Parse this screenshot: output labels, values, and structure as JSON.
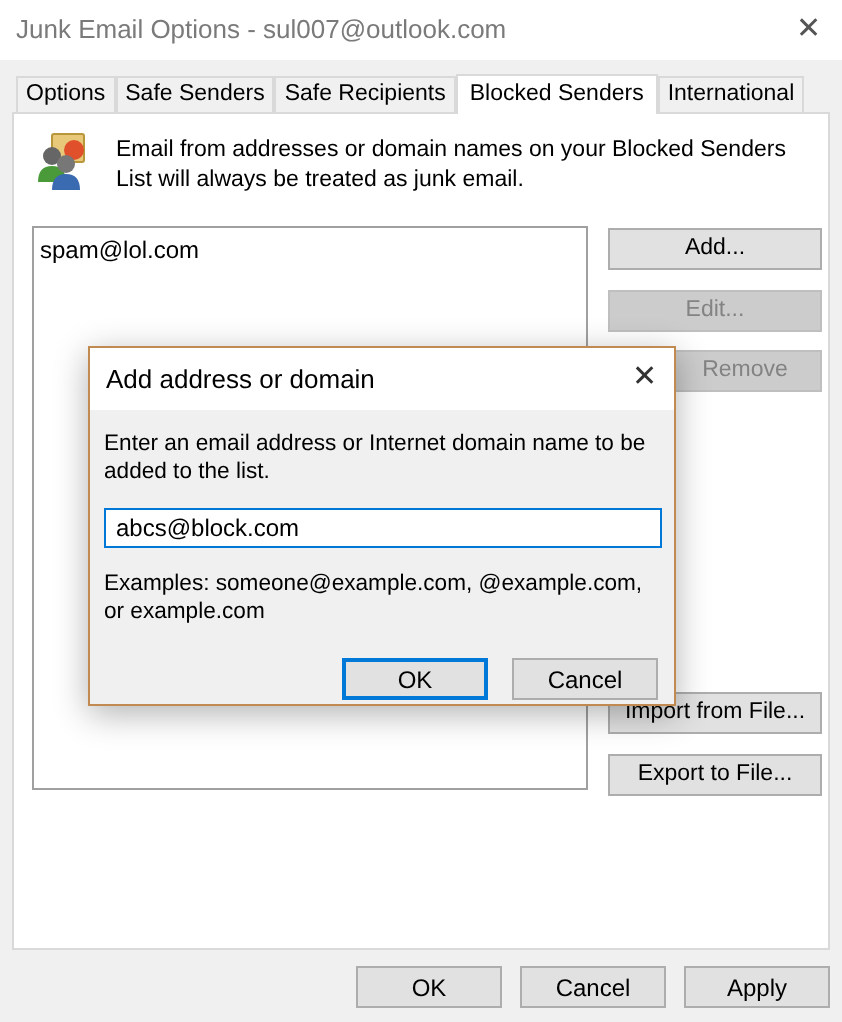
{
  "window": {
    "title": "Junk Email Options - sul007@outlook.com",
    "close": "✕"
  },
  "tabs": [
    {
      "label": "Options",
      "selected": false
    },
    {
      "label": "Safe Senders",
      "selected": false
    },
    {
      "label": "Safe Recipients",
      "selected": false
    },
    {
      "label": "Blocked Senders",
      "selected": true
    },
    {
      "label": "International",
      "selected": false
    }
  ],
  "description": "Email from addresses or domain names on your Blocked Senders List will always be treated as junk email.",
  "list": {
    "items": [
      "spam@lol.com"
    ]
  },
  "side_buttons": [
    {
      "label": "Add...",
      "disabled": false
    },
    {
      "label": "Edit...",
      "disabled": true
    },
    {
      "label": "Remove",
      "disabled": true
    },
    {
      "label": "Import from File...",
      "disabled": false
    },
    {
      "label": "Export to File...",
      "disabled": false
    }
  ],
  "footer_buttons": [
    {
      "label": "OK"
    },
    {
      "label": "Cancel"
    },
    {
      "label": "Apply"
    }
  ],
  "dialog": {
    "title": "Add address or domain",
    "close": "✕",
    "prompt": "Enter an email address or Internet domain name to be added to the list.",
    "value": "abcs@block.com",
    "examples": "Examples: someone@example.com, @example.com, or example.com",
    "buttons": [
      {
        "label": "OK",
        "focused": true
      },
      {
        "label": "Cancel",
        "focused": false
      }
    ]
  }
}
